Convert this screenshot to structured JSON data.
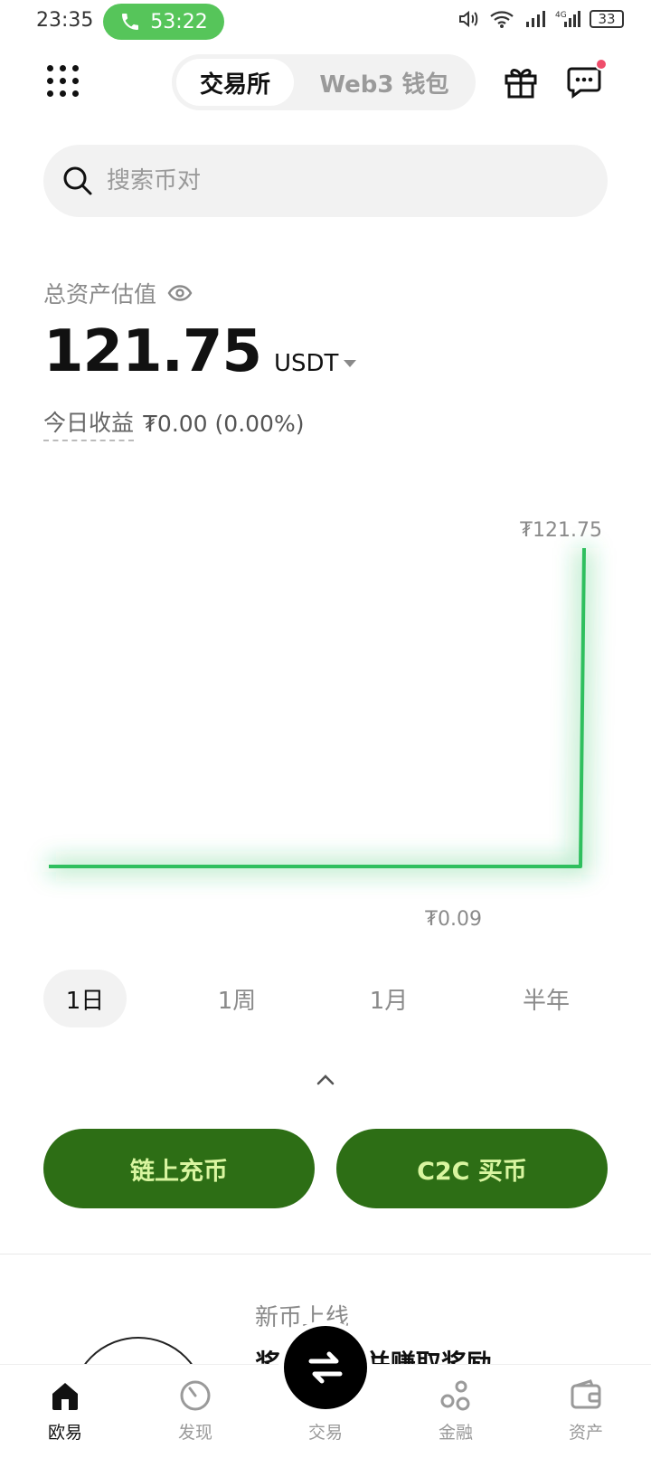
{
  "status_bar": {
    "time": "23:35",
    "call_duration": "53:22",
    "battery": "33"
  },
  "header": {
    "tabs": [
      "交易所",
      "Web3 钱包"
    ],
    "active_tab": "交易所"
  },
  "search": {
    "placeholder": "搜索币对"
  },
  "asset": {
    "label": "总资产估值",
    "value": "121.75",
    "unit": "USDT",
    "pnl_label": "今日收益",
    "pnl_value": "₮0.00 (0.00%)"
  },
  "chart": {
    "max_label": "₮121.75",
    "min_label": "₮0.09",
    "line_color": "#2fbf5e"
  },
  "chart_data": {
    "type": "line",
    "x": [
      0,
      1,
      2,
      3,
      4,
      5,
      6,
      7,
      8,
      9,
      10,
      11,
      12,
      13,
      14,
      15,
      16,
      17,
      18,
      19,
      20
    ],
    "series": [
      {
        "values": [
          0.09,
          0.09,
          0.09,
          0.09,
          0.09,
          0.09,
          0.09,
          0.09,
          0.09,
          0.09,
          0.09,
          0.09,
          0.09,
          0.09,
          0.09,
          0.09,
          0.09,
          0.09,
          0.09,
          0.09,
          121.75
        ]
      }
    ],
    "ylim": [
      0.09,
      121.75
    ],
    "grid": false
  },
  "periods": {
    "items": [
      "1日",
      "1周",
      "1月",
      "半年"
    ],
    "active": "1日"
  },
  "actions": {
    "deposit": "链上充币",
    "buy": "C2C 买币"
  },
  "promo": {
    "title": "新币上线",
    "subtitle": "奖励 交易并赚取奖励"
  },
  "bottom_nav": {
    "items": [
      "欧易",
      "发现",
      "交易",
      "金融",
      "资产"
    ],
    "active": "欧易"
  },
  "colors": {
    "accent_green": "#2d6e15",
    "accent_text": "#d9f5a0",
    "call_green": "#56c55a",
    "notify_dot": "#ef4d6b"
  }
}
